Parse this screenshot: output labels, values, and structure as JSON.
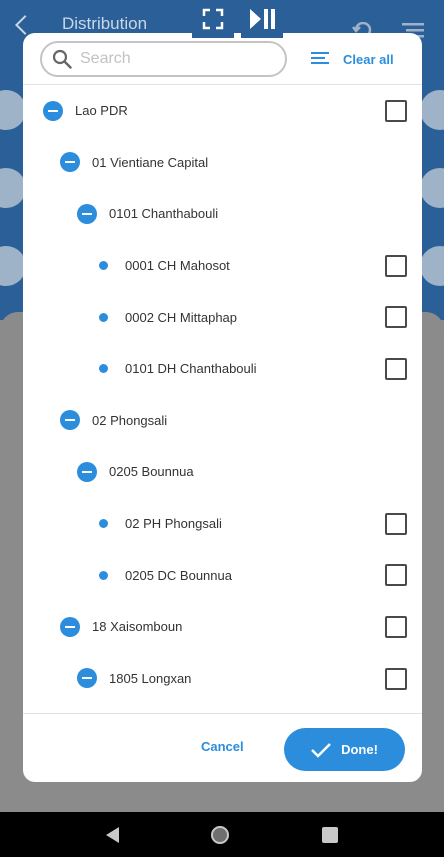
{
  "background": {
    "title": "Distribution"
  },
  "search": {
    "placeholder": "Search",
    "value": ""
  },
  "toolbar": {
    "clear_all_label": "Clear all"
  },
  "tree": [
    {
      "label": "Lao PDR",
      "level": 0,
      "kind": "group",
      "checkbox": true
    },
    {
      "label": "01 Vientiane Capital",
      "level": 1,
      "kind": "group",
      "checkbox": false
    },
    {
      "label": "0101 Chanthabouli",
      "level": 2,
      "kind": "group",
      "checkbox": false
    },
    {
      "label": "0001 CH Mahosot",
      "level": 3,
      "kind": "leaf",
      "checkbox": true
    },
    {
      "label": "0002 CH Mittaphap",
      "level": 3,
      "kind": "leaf",
      "checkbox": true
    },
    {
      "label": "0101 DH Chanthabouli",
      "level": 3,
      "kind": "leaf",
      "checkbox": true
    },
    {
      "label": "02 Phongsali",
      "level": 1,
      "kind": "group",
      "checkbox": false
    },
    {
      "label": "0205 Bounnua",
      "level": 2,
      "kind": "group",
      "checkbox": false
    },
    {
      "label": "02 PH Phongsali",
      "level": 3,
      "kind": "leaf",
      "checkbox": true
    },
    {
      "label": "0205 DC Bounnua",
      "level": 3,
      "kind": "leaf",
      "checkbox": true
    },
    {
      "label": "18 Xaisomboun",
      "level": 1,
      "kind": "group",
      "checkbox": true
    },
    {
      "label": "1805 Longxan",
      "level": 2,
      "kind": "group",
      "checkbox": true
    }
  ],
  "footer": {
    "cancel_label": "Cancel",
    "done_label": "Done!"
  },
  "colors": {
    "accent": "#2b8ddc",
    "app_bar": "#2b5f97",
    "scrim": "#8a8a8a"
  }
}
